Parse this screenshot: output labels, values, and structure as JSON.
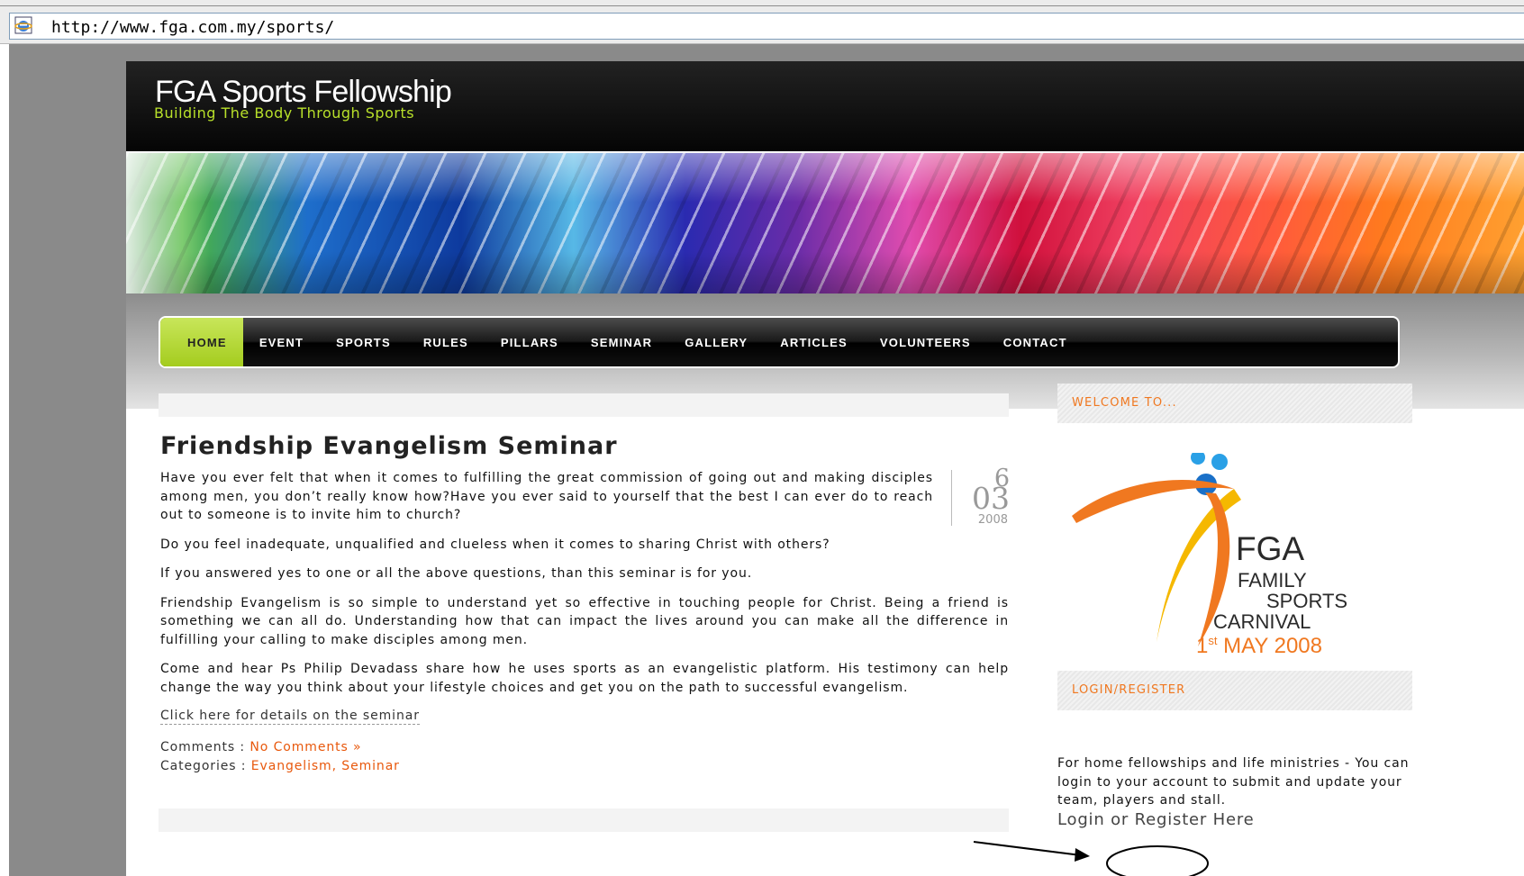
{
  "browser": {
    "url": "http://www.fga.com.my/sports/"
  },
  "site": {
    "title": "FGA Sports Fellowship",
    "tagline": "Building The Body Through Sports"
  },
  "nav": {
    "items": [
      "HOME",
      "EVENT",
      "SPORTS",
      "RULES",
      "PILLARS",
      "SEMINAR",
      "GALLERY",
      "ARTICLES",
      "VOLUNTEERS",
      "CONTACT"
    ],
    "active": "HOME"
  },
  "post": {
    "title": "Friendship Evangelism Seminar",
    "date": {
      "day": "6",
      "month": "03",
      "year": "2008"
    },
    "paragraphs": [
      "Have you ever felt that when it comes to fulfilling the great commission of going out and making disciples among men, you don’t really know how?Have you ever said to yourself that the best I can ever do to reach out to someone is to invite him to church?",
      "Do you feel inadequate, unqualified and clueless when it comes to sharing Christ with others?",
      "If you answered yes to one or all the above questions, than this seminar is for you.",
      "Friendship Evangelism is so simple to understand yet so effective in touching people for Christ. Being a friend is something we can all do. Understanding how that can impact the lives around you can make all the difference in fulfilling your calling to make disciples among men.",
      "Come and hear Ps Philip Devadass share how he uses sports as an evangelistic platform. His testimony can help change the way you think about your lifestyle choices and get you on the path to successful evangelism."
    ],
    "details_link": "Click here for details on the seminar",
    "comments_label": "Comments :",
    "comments_link": "No Comments »",
    "categories_label": "Categories :",
    "categories_link": "Evangelism, Seminar"
  },
  "sidebar": {
    "welcome_heading": "WELCOME TO...",
    "logo": {
      "fga": "FGA",
      "line1": "FAMILY",
      "line2": "SPORTS",
      "line3": "CARNIVAL",
      "date_prefix": "1",
      "date_sup": "st",
      "date_rest": " MAY 2008"
    },
    "login_heading": "LOGIN/REGISTER",
    "login_text": "For home fellowships and life ministries - You can login to your account to submit and update your team, players and stall.",
    "login_link": "Login",
    "register_text": " or Register Here"
  },
  "colors": {
    "accent_green": "#a4cc1e",
    "accent_orange": "#f07820",
    "link_orange": "#e8580c"
  },
  "icons": [
    "ie-page-icon",
    "annotation-arrow-icon"
  ]
}
